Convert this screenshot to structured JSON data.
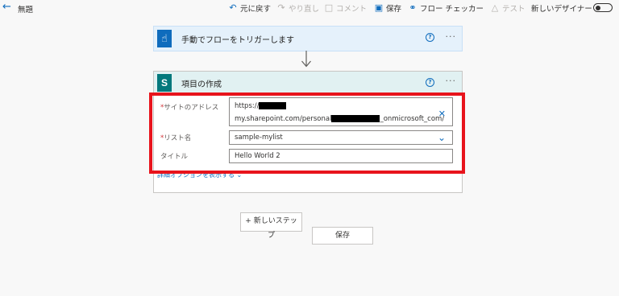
{
  "topbar": {
    "back_icon": "arrow-left-icon",
    "title": "無題",
    "items": [
      {
        "label": "元に戻す",
        "icon": "undo-icon"
      },
      {
        "label": "やり直し",
        "icon": "redo-icon"
      },
      {
        "label": "コメント",
        "icon": "comment-icon"
      },
      {
        "label": "保存",
        "icon": "save-icon"
      },
      {
        "label": "フロー チェッカー",
        "icon": "stethoscope-icon"
      },
      {
        "label": "テスト",
        "icon": "flask-icon"
      }
    ],
    "new_designer_label": "新しいデザイナー",
    "new_designer_enabled": false
  },
  "trigger_card": {
    "title": "手動でフローをトリガーします",
    "icon": "touch-hand-icon",
    "help_icon": "help-circle-icon",
    "more_icon": "more-icon"
  },
  "action_card": {
    "title": "項目の作成",
    "icon": "sharepoint-icon",
    "help_icon": "help-circle-icon",
    "more_icon": "more-icon",
    "fields": {
      "site_address": {
        "label": "サイトのアドレス",
        "required_mark": "*",
        "line1": "https://",
        "line2_prefix": "my.sharepoint.com/personal",
        "line2_suffix": "_onmicrosoft_com/"
      },
      "list_name": {
        "label": "リスト名",
        "required_mark": "*",
        "value": "sample-mylist"
      },
      "title": {
        "label": "タイトル",
        "value": "Hello World 2"
      }
    },
    "advanced_link": "詳細オプションを表示する"
  },
  "buttons": {
    "new_step_line1": "+ 新しいステッ",
    "new_step_line2": "プ",
    "save": "保存"
  },
  "colors": {
    "accent": "#0f6cbd",
    "trigger_header": "#e5f1fb",
    "action_header": "#e1f1f2",
    "sharepoint": "#03787c",
    "highlight_frame": "#e8141c"
  }
}
